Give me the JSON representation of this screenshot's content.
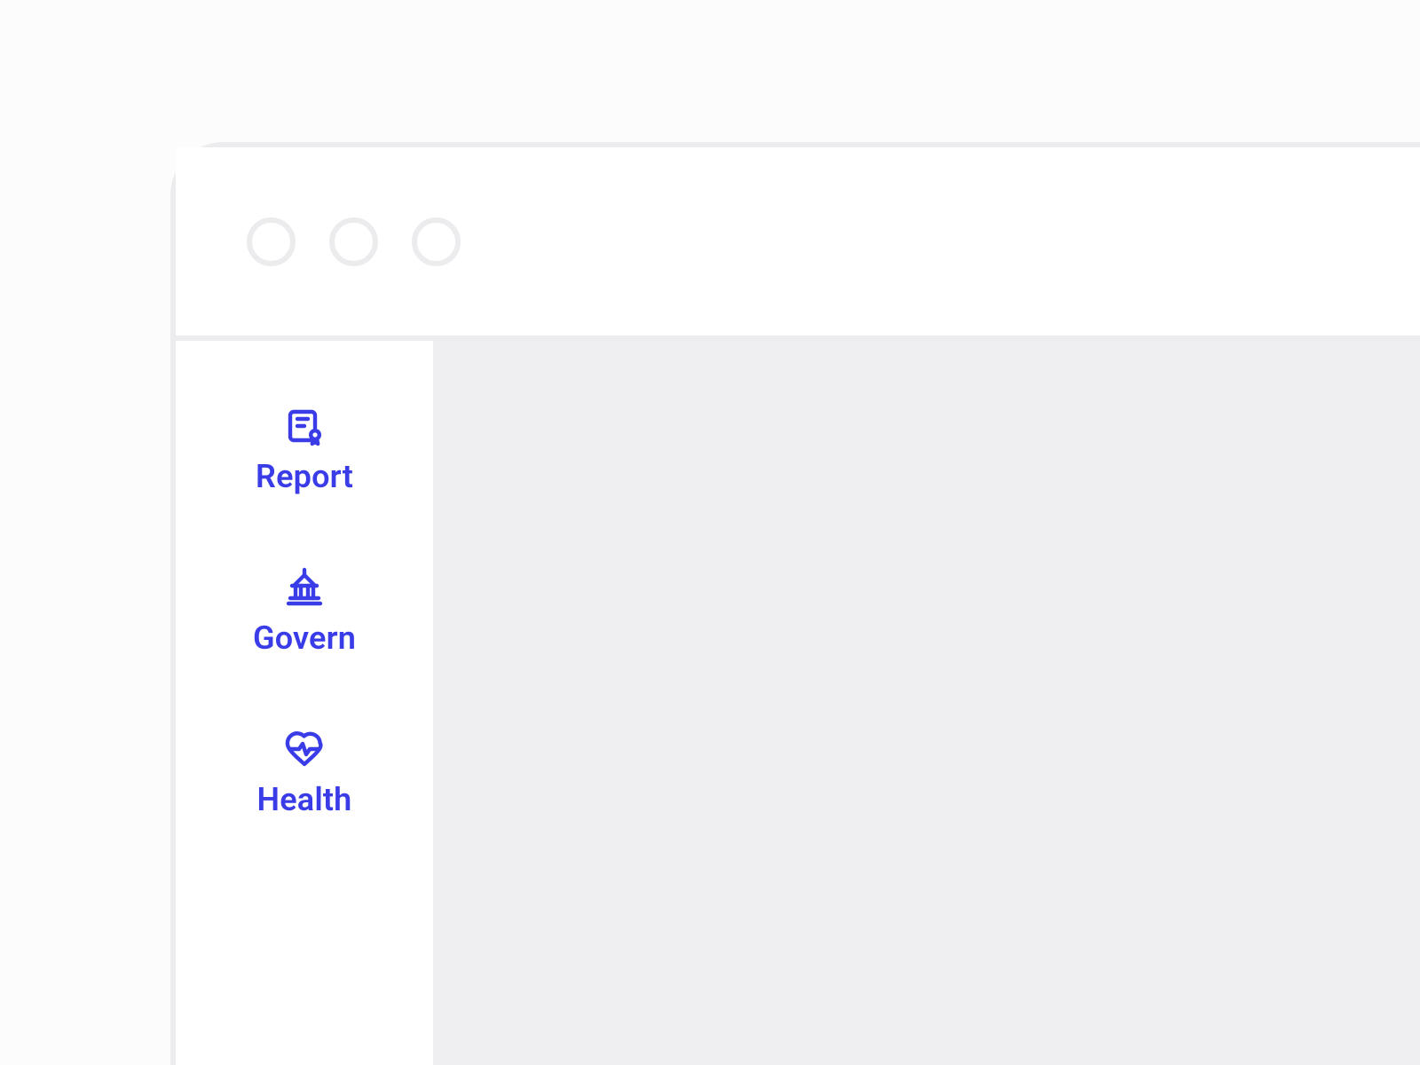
{
  "colors": {
    "accent": "#3A3CE8",
    "frame": "#ECECEE",
    "content_bg": "#EFEFF1"
  },
  "window": {
    "traffic_lights_count": 3
  },
  "sidebar": {
    "items": [
      {
        "icon": "certificate-icon",
        "label": "Report"
      },
      {
        "icon": "government-icon",
        "label": "Govern"
      },
      {
        "icon": "heart-pulse-icon",
        "label": "Health"
      }
    ]
  }
}
